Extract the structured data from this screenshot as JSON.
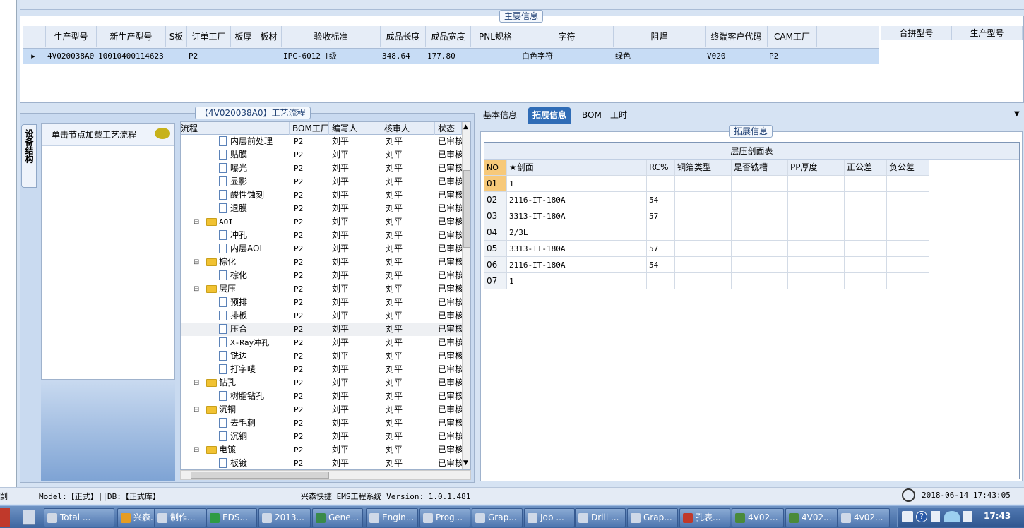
{
  "main_info": {
    "legend": "主要信息",
    "columns": [
      "生产型号",
      "新生产型号",
      "S板",
      "订单工厂",
      "板厚",
      "板材",
      "验收标准",
      "成品长度",
      "成品宽度",
      "PNL规格",
      "字符",
      "阻焊",
      "终端客户代码",
      "CAM工厂"
    ],
    "row": [
      "4V020038A0",
      "10010400114623",
      "",
      "P2",
      "",
      "",
      "IPC-6012 Ⅱ级",
      "348.64",
      "177.80",
      "",
      "白色字符",
      "绿色",
      "V020",
      "P2"
    ],
    "side_columns": [
      "合拼型号",
      "生产型号"
    ]
  },
  "process": {
    "legend": "【4V020038A0】工艺流程",
    "side_tab": "设备结构",
    "load_hint": "单击节点加载工艺流程",
    "columns": [
      "流程",
      "BOM工厂",
      "编写人",
      "核审人",
      "状态"
    ],
    "rows": [
      {
        "name": "内层前处理",
        "type": "doc",
        "lvl": 2,
        "fac": "P2",
        "w": "刘平",
        "r": "刘平",
        "s": "已审核"
      },
      {
        "name": "贴膜",
        "type": "doc",
        "lvl": 2,
        "fac": "P2",
        "w": "刘平",
        "r": "刘平",
        "s": "已审核"
      },
      {
        "name": "曝光",
        "type": "doc",
        "lvl": 2,
        "fac": "P2",
        "w": "刘平",
        "r": "刘平",
        "s": "已审核"
      },
      {
        "name": "显影",
        "type": "doc",
        "lvl": 2,
        "fac": "P2",
        "w": "刘平",
        "r": "刘平",
        "s": "已审核"
      },
      {
        "name": "酸性蚀刻",
        "type": "doc",
        "lvl": 2,
        "fac": "P2",
        "w": "刘平",
        "r": "刘平",
        "s": "已审核"
      },
      {
        "name": "退膜",
        "type": "doc",
        "lvl": 2,
        "fac": "P2",
        "w": "刘平",
        "r": "刘平",
        "s": "已审核"
      },
      {
        "name": "AOI",
        "type": "folder",
        "lvl": 1,
        "fac": "P2",
        "w": "刘平",
        "r": "刘平",
        "s": "已审核"
      },
      {
        "name": "冲孔",
        "type": "doc",
        "lvl": 2,
        "fac": "P2",
        "w": "刘平",
        "r": "刘平",
        "s": "已审核"
      },
      {
        "name": "内层AOI",
        "type": "doc",
        "lvl": 2,
        "fac": "P2",
        "w": "刘平",
        "r": "刘平",
        "s": "已审核"
      },
      {
        "name": "棕化",
        "type": "folder",
        "lvl": 1,
        "fac": "P2",
        "w": "刘平",
        "r": "刘平",
        "s": "已审核"
      },
      {
        "name": "棕化",
        "type": "doc",
        "lvl": 2,
        "fac": "P2",
        "w": "刘平",
        "r": "刘平",
        "s": "已审核"
      },
      {
        "name": "层压",
        "type": "folder",
        "lvl": 1,
        "fac": "P2",
        "w": "刘平",
        "r": "刘平",
        "s": "已审核"
      },
      {
        "name": "预排",
        "type": "doc",
        "lvl": 2,
        "fac": "P2",
        "w": "刘平",
        "r": "刘平",
        "s": "已审核"
      },
      {
        "name": "排板",
        "type": "doc",
        "lvl": 2,
        "fac": "P2",
        "w": "刘平",
        "r": "刘平",
        "s": "已审核"
      },
      {
        "name": "压合",
        "type": "doc",
        "lvl": 2,
        "fac": "P2",
        "w": "刘平",
        "r": "刘平",
        "s": "已审核"
      },
      {
        "name": "X-Ray冲孔",
        "type": "doc",
        "lvl": 2,
        "fac": "P2",
        "w": "刘平",
        "r": "刘平",
        "s": "已审核"
      },
      {
        "name": "铣边",
        "type": "doc",
        "lvl": 2,
        "fac": "P2",
        "w": "刘平",
        "r": "刘平",
        "s": "已审核"
      },
      {
        "name": "打字唛",
        "type": "doc",
        "lvl": 2,
        "fac": "P2",
        "w": "刘平",
        "r": "刘平",
        "s": "已审核"
      },
      {
        "name": "钻孔",
        "type": "folder",
        "lvl": 1,
        "fac": "P2",
        "w": "刘平",
        "r": "刘平",
        "s": "已审核"
      },
      {
        "name": "树脂钻孔",
        "type": "doc",
        "lvl": 2,
        "fac": "P2",
        "w": "刘平",
        "r": "刘平",
        "s": "已审核"
      },
      {
        "name": "沉铜",
        "type": "folder",
        "lvl": 1,
        "fac": "P2",
        "w": "刘平",
        "r": "刘平",
        "s": "已审核"
      },
      {
        "name": "去毛刺",
        "type": "doc",
        "lvl": 2,
        "fac": "P2",
        "w": "刘平",
        "r": "刘平",
        "s": "已审核"
      },
      {
        "name": "沉铜",
        "type": "doc",
        "lvl": 2,
        "fac": "P2",
        "w": "刘平",
        "r": "刘平",
        "s": "已审核"
      },
      {
        "name": "电镀",
        "type": "folder",
        "lvl": 1,
        "fac": "P2",
        "w": "刘平",
        "r": "刘平",
        "s": "已审核"
      },
      {
        "name": "板镀",
        "type": "doc",
        "lvl": 2,
        "fac": "P2",
        "w": "刘平",
        "r": "刘平",
        "s": "已审核"
      }
    ]
  },
  "right": {
    "tabs": [
      "基本信息",
      "拓展信息",
      "BOM",
      "工时"
    ],
    "active_tab": 1,
    "legend": "拓展信息",
    "table_title": "层压剖面表",
    "columns": [
      "NO",
      "★剖面",
      "RC%",
      "铜箔类型",
      "是否铣槽",
      "PP厚度",
      "正公差",
      "负公差"
    ],
    "rows": [
      [
        "01",
        "1",
        "",
        "",
        "",
        "",
        "",
        ""
      ],
      [
        "02",
        "2116-IT-180A",
        "54",
        "",
        "",
        "",
        "",
        ""
      ],
      [
        "03",
        "3313-IT-180A",
        "57",
        "",
        "",
        "",
        "",
        ""
      ],
      [
        "04",
        "2/3L",
        "",
        "",
        "",
        "",
        "",
        ""
      ],
      [
        "05",
        "3313-IT-180A",
        "57",
        "",
        "",
        "",
        "",
        ""
      ],
      [
        "06",
        "2116-IT-180A",
        "54",
        "",
        "",
        "",
        "",
        ""
      ],
      [
        "07",
        "1",
        "",
        "",
        "",
        "",
        "",
        ""
      ]
    ]
  },
  "status": {
    "left_text": "剀",
    "model": "Model:【正式】||DB:【正式库】",
    "system": "兴森快捷 EMS工程系统 Version: 1.0.1.481",
    "datetime": "2018-06-14 17:43:05"
  },
  "taskbar": {
    "items": [
      "Total ...",
      "兴森...",
      "制作...",
      "EDS...",
      "2013...",
      "Gene...",
      "Engin...",
      "Prog...",
      "Grap...",
      "Job ...",
      "Drill ...",
      "Grap...",
      "孔表...",
      "4V02...",
      "4V02...",
      "4v02..."
    ],
    "clock": "17:43",
    "colors": {
      "bar": "#3d66a0",
      "accent": "#2f6cb6"
    }
  }
}
